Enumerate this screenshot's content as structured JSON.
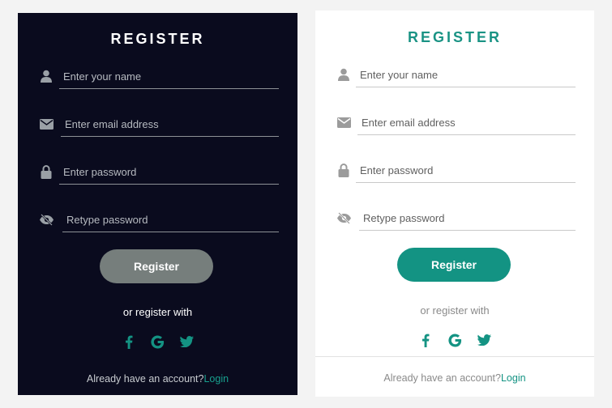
{
  "dark_form": {
    "title": "REGISTER",
    "fields": [
      {
        "icon": "user-icon",
        "placeholder": "Enter your name",
        "value": ""
      },
      {
        "icon": "envelope-icon",
        "placeholder": "Enter email address",
        "value": ""
      },
      {
        "icon": "lock-icon",
        "placeholder": "Enter password",
        "value": ""
      },
      {
        "icon": "eye-slash-icon",
        "placeholder": "Retype password",
        "value": ""
      }
    ],
    "submit_label": "Register",
    "or_text": "or register with",
    "socials": [
      "facebook-icon",
      "google-icon",
      "twitter-icon"
    ],
    "footer_text": "Already have an account?",
    "footer_link": "Login",
    "colors": {
      "background": "#0a0b1e",
      "button": "#767e7c",
      "accent": "#149383"
    }
  },
  "light_form": {
    "title": "REGISTER",
    "fields": [
      {
        "icon": "user-icon",
        "placeholder": "Enter your name",
        "value": ""
      },
      {
        "icon": "envelope-icon",
        "placeholder": "Enter email address",
        "value": ""
      },
      {
        "icon": "lock-icon",
        "placeholder": "Enter password",
        "value": ""
      },
      {
        "icon": "eye-slash-icon",
        "placeholder": "Retype password",
        "value": ""
      }
    ],
    "submit_label": "Register",
    "or_text": "or register with",
    "socials": [
      "facebook-icon",
      "google-icon",
      "twitter-icon"
    ],
    "footer_text": "Already have an account?",
    "footer_link": "Login",
    "colors": {
      "background": "#ffffff",
      "button": "#139383",
      "accent": "#149383"
    }
  }
}
